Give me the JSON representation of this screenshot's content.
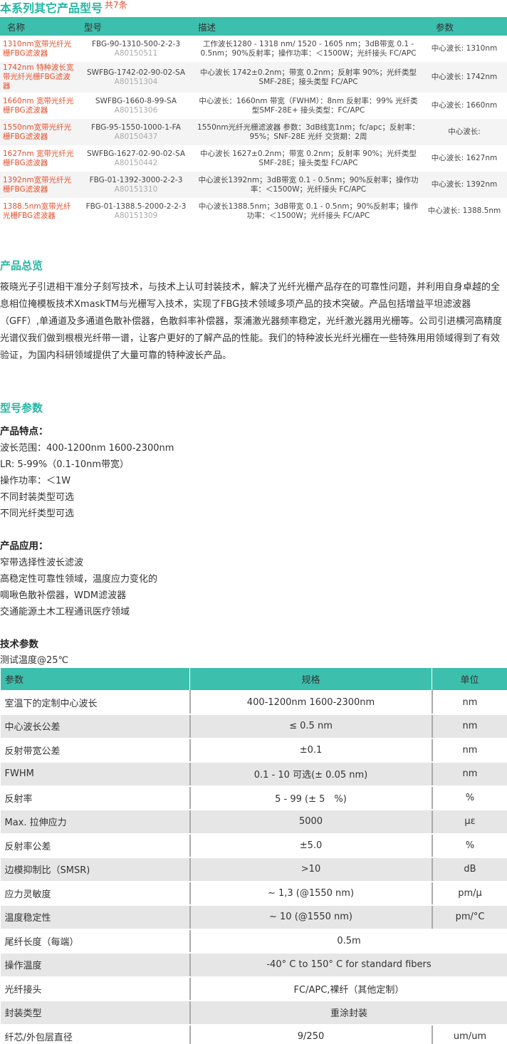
{
  "series": {
    "title": "本系列其它产品型号",
    "count": "共7条"
  },
  "products": {
    "headers": {
      "name": "名称",
      "model": "型号",
      "desc": "描述",
      "param": "参数"
    },
    "rows": [
      {
        "name": "1310nm宽带光纤光栅FBG滤波器",
        "model": "FBG-90-1310-500-2-2-3",
        "code": "A80150511",
        "desc": "工作波长1280 - 1318 nm/ 1520 - 1605 nm；3dB带宽 0.1 - 0.5nm；90%反射率；操作功率：＜1500W；光纤接头 FC/APC",
        "param": "中心波长: 1310nm"
      },
      {
        "name": "1742nm 特种波长宽带光纤光栅FBG滤波器",
        "model": "SWFBG-1742-02-90-02-SA",
        "code": "A80151304",
        "desc": "中心波长 1742±0.2nm；带宽 0.2nm；反射率 90%；光纤类型 SMF-28E；接头类型 FC/APC",
        "param": "中心波长: 1742nm"
      },
      {
        "name": "1660nm 宽带光纤光栅FBG滤波器",
        "model": "SWFBG-1660-8-99-SA",
        "code": "A80151306",
        "desc": "中心波长：1660nm 带宽（FWHM）：8nm 反射率：99% 光纤类型SMF-28E+ 接头类型：FC/APC",
        "param": "中心波长: 1660nm"
      },
      {
        "name": "1550nm宽带光纤光栅FBG滤波器",
        "model": "FBG-95-1550-1000-1-FA",
        "code": "A80150437",
        "desc": "1550nm光纤光栅滤波器 参数：3dB线宽1nm；fc/apc；反射率：95%；SNF-28E 光纤 交货期：2周",
        "param": "中心波长:"
      },
      {
        "name": "1627nm 宽带光纤光栅FBG滤波器",
        "model": "SWFBG-1627-02-90-02-SA",
        "code": "A80150442",
        "desc": "中心波长 1627±0.2nm；带宽 0.2nm；反射率 90%；光纤类型 SMF-28E；接头类型 FC/APC",
        "param": "中心波长: 1627nm"
      },
      {
        "name": "1392nm宽带光纤光栅FBG滤波器",
        "model": "FBG-01-1392-3000-2-2-3",
        "code": "A80151310",
        "desc": "中心波长1392nm；3dB带宽 0.1 - 0.5nm；90%反射率；操作功率：＜1500W；光纤接头 FC/APC",
        "param": "中心波长: 1392nm"
      },
      {
        "name": "1388.5nm宽带光纤光栅FBG滤波器",
        "model": "FBG-01-1388.5-2000-2-2-3",
        "code": "A80151309",
        "desc": "中心波长1388.5nm；3dB带宽 0.1 - 0.5nm；90%反射率；操作功率：＜1500W；光纤接头 FC/APC",
        "param": "中心波长: 1388.5nm"
      }
    ]
  },
  "overview": {
    "title": "产品总览",
    "text": "筱晓光子引进相干准分子刻写技术，与技术上认可封装技术，解决了光纤光栅产品存在的可靠性问题，并利用自身卓越的全息相位掩模板技术XmaskTM与光栅写入技术，实现了FBG技术领域多项产品的技术突破。产品包括增益平坦滤波器（GFF）,单通道及多通道色散补偿器，色散斜率补偿器，泵浦激光器频率稳定，光纤激光器用光栅等。公司引进横河高精度光谱仪我们做到根根光纤带一谱，让客户更好的了解产品的性能。我们的特种波长光纤光栅在一些特殊用用领域得到了有效验证，为国内科研领域提供了大量可靠的特种波长产品。"
  },
  "model_params": {
    "title": "型号参数",
    "features_title": "产品特点：",
    "features": [
      "波长范围：400-1200nm 1600-2300nm",
      "LR: 5-99%（0.1-10nm带宽）",
      "操作功率：＜1W",
      "不同封装类型可选",
      "不同光纤类型可选"
    ],
    "applications_title": "产品应用：",
    "applications": [
      "窄带选择性波长滤波",
      "高稳定性可靠性领域，温度应力变化的",
      "啁啾色散补偿器，WDM滤波器",
      "交通能源土木工程通讯医疗领域"
    ],
    "tech_title": "技术参数",
    "test_temp": "测试温度@25℃"
  },
  "spec": {
    "headers": {
      "param": "参数",
      "value": "规格",
      "unit": "单位"
    },
    "rows": [
      {
        "param": "室温下的定制中心波长",
        "value": "400-1200nm 1600-2300nm",
        "unit": "nm"
      },
      {
        "param": "中心波长公差",
        "value": "≤ 0.5 nm",
        "unit": "nm"
      },
      {
        "param": "反射带宽公差",
        "value": "±0.1",
        "unit": "nm"
      },
      {
        "param": "FWHM",
        "value": "0.1 - 10 可选(± 0.05 nm)",
        "unit": "nm"
      },
      {
        "param": "反射率",
        "value": "5 - 99 (± 5　%)",
        "unit": "%"
      },
      {
        "param": "Max. 拉伸应力",
        "value": "5000",
        "unit": "µε"
      },
      {
        "param": "反射率公差",
        "value": "±5.0",
        "unit": "%"
      },
      {
        "param": "边模抑制比（SMSR)",
        "value": ">10",
        "unit": "dB"
      },
      {
        "param": "应力灵敏度",
        "value": "~ 1,3 (@1550 nm)",
        "unit": "pm/µ"
      },
      {
        "param": "温度稳定性",
        "value": "~ 10 (@1550 nm)",
        "unit": "pm/°C"
      },
      {
        "param": "尾纤长度（每端）",
        "value": "0.5m",
        "unit": ""
      },
      {
        "param": "操作温度",
        "value": "-40° C to 150° C for standard fibers",
        "unit": ""
      },
      {
        "param": "光纤接头",
        "value": "FC/APC,裸纤（其他定制）",
        "unit": ""
      },
      {
        "param": "封装类型",
        "value": "重涂封装",
        "unit": ""
      },
      {
        "param": "纤芯/外包层直径",
        "value": "9/250",
        "unit": "um/um"
      }
    ]
  }
}
